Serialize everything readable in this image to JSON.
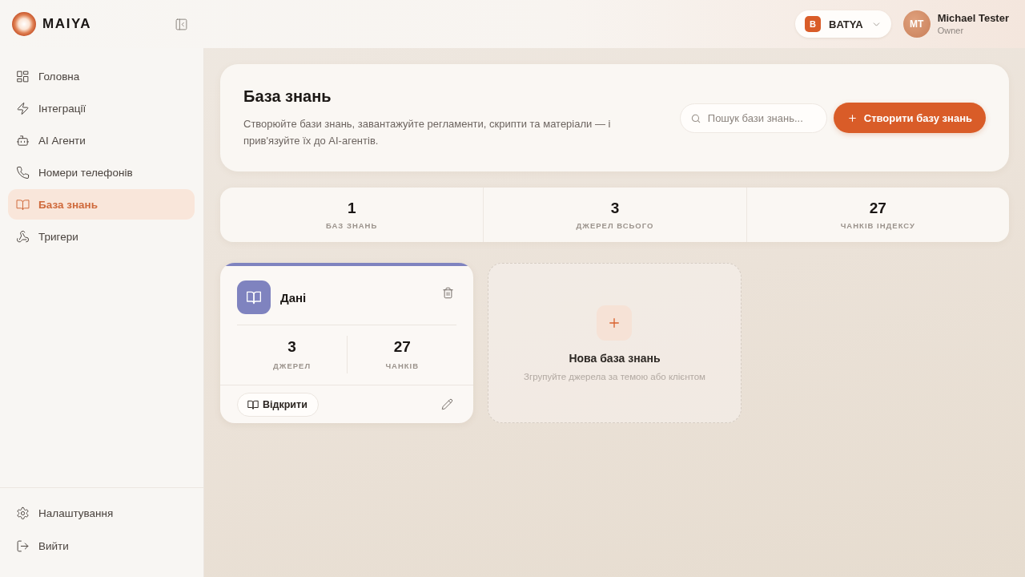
{
  "brand": {
    "name": "MAIYA"
  },
  "workspace": {
    "initial": "B",
    "name": "BATYA"
  },
  "user": {
    "initials": "MT",
    "name": "Michael Tester",
    "role": "Owner"
  },
  "sidebar": {
    "items": [
      {
        "label": "Головна",
        "selected": false
      },
      {
        "label": "Інтеграції",
        "selected": false
      },
      {
        "label": "AI Агенти",
        "selected": false
      },
      {
        "label": "Номери телефонів",
        "selected": false
      },
      {
        "label": "База знань",
        "selected": true
      },
      {
        "label": "Тригери",
        "selected": false
      }
    ],
    "footer_items": [
      {
        "label": "Налаштування"
      },
      {
        "label": "Вийти"
      }
    ]
  },
  "header": {
    "title": "База знань",
    "description": "Створюйте бази знань, завантажуйте регламенти, скрипти та матеріали — і прив'язуйте їх до AI-агентів.",
    "search": {
      "placeholder": "Пошук бази знань..."
    },
    "create_button": "Створити базу знань"
  },
  "stats": [
    {
      "value": "1",
      "label": "БАЗ ЗНАНЬ"
    },
    {
      "value": "3",
      "label": "ДЖЕРЕЛ ВСЬОГО"
    },
    {
      "value": "27",
      "label": "ЧАНКІВ ІНДЕКСУ"
    }
  ],
  "knowledge_bases": [
    {
      "title": "Дані",
      "color": "#7f83bf",
      "stats": [
        {
          "value": "3",
          "label": "ДЖЕРЕЛ"
        },
        {
          "value": "27",
          "label": "ЧАНКІВ"
        }
      ],
      "open_button": "Відкрити"
    }
  ],
  "new_card": {
    "title": "Нова база знань",
    "subtitle": "Згрупуйте джерела за темою або клієнтом"
  }
}
